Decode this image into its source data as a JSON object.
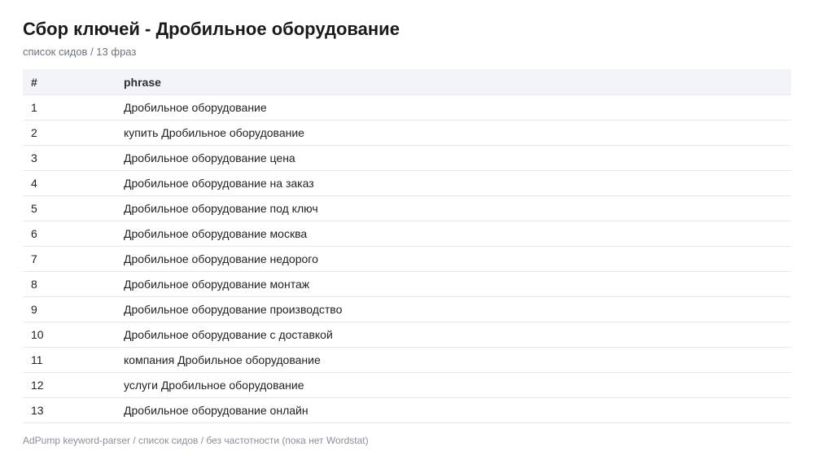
{
  "header": {
    "title": "Сбор ключей - Дробильное оборудование",
    "subtitle": "список сидов / 13 фраз"
  },
  "table": {
    "columns": [
      "#",
      "phrase"
    ],
    "rows": [
      {
        "num": "1",
        "phrase": "Дробильное оборудование"
      },
      {
        "num": "2",
        "phrase": "купить Дробильное оборудование"
      },
      {
        "num": "3",
        "phrase": "Дробильное оборудование цена"
      },
      {
        "num": "4",
        "phrase": "Дробильное оборудование на заказ"
      },
      {
        "num": "5",
        "phrase": "Дробильное оборудование под ключ"
      },
      {
        "num": "6",
        "phrase": "Дробильное оборудование москва"
      },
      {
        "num": "7",
        "phrase": "Дробильное оборудование недорого"
      },
      {
        "num": "8",
        "phrase": "Дробильное оборудование монтаж"
      },
      {
        "num": "9",
        "phrase": "Дробильное оборудование производство"
      },
      {
        "num": "10",
        "phrase": "Дробильное оборудование с доставкой"
      },
      {
        "num": "11",
        "phrase": "компания Дробильное оборудование"
      },
      {
        "num": "12",
        "phrase": "услуги Дробильное оборудование"
      },
      {
        "num": "13",
        "phrase": "Дробильное оборудование онлайн"
      }
    ]
  },
  "footer": {
    "text": "AdPump keyword-parser / список сидов / без частотности (пока нет Wordstat)"
  }
}
